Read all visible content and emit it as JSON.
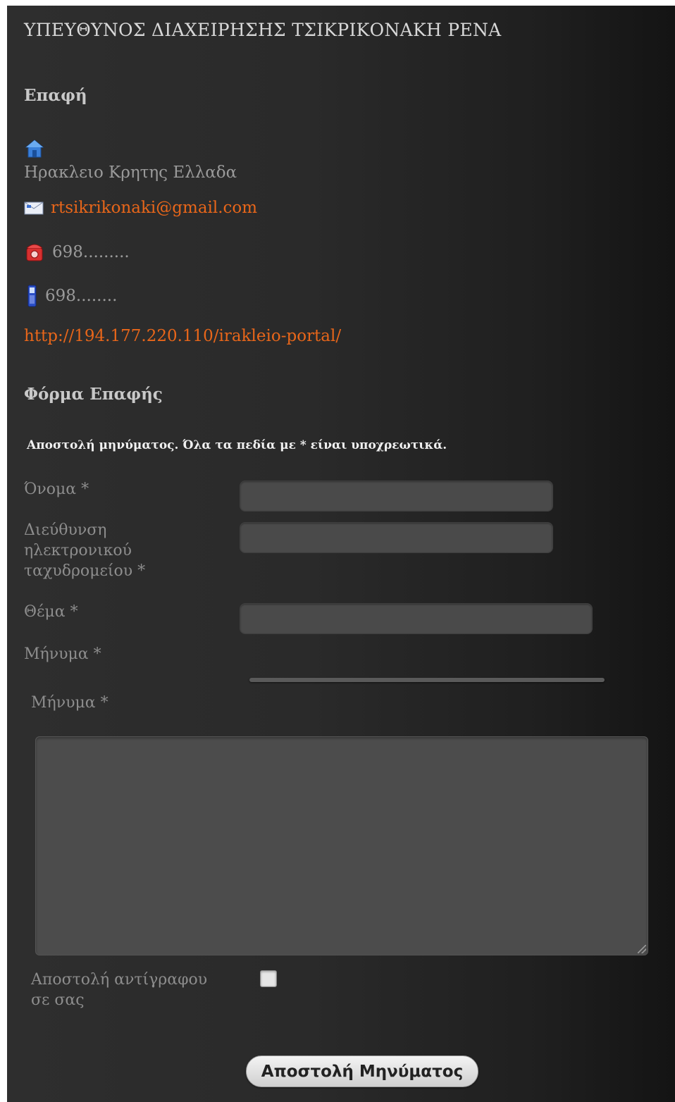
{
  "header": {
    "title": "ΥΠΕΥΘΥΝΟΣ ΔΙΑΧΕΙΡΗΣΗΣ ΤΣΙΚΡΙΚΟΝΑΚΗ ΡΕΝΑ"
  },
  "contact": {
    "heading": "Επαφή",
    "address_icon": "house-icon",
    "address": "Ηρακλειο Κρητης Ελλαδα",
    "email_icon": "envelope-icon",
    "email": "rtsikrikonaki@gmail.com",
    "phone_icon": "telephone-icon",
    "phone": "698.........",
    "mobile_icon": "mobile-phone-icon",
    "mobile": "698........",
    "website": "http://194.177.220.110/irakleio-portal/"
  },
  "form": {
    "heading": "Φόρμα Επαφής",
    "notice": "Αποστολή μηνύματος. Όλα τα πεδία με * είναι υποχρεωτικά.",
    "name_label": "Όνομα *",
    "email_label": "Διεύθυνση ηλεκτρονικού ταχυδρομείου *",
    "subject_label": "Θέμα *",
    "message_label": "Μήνυμα *",
    "message_label_2": "Μήνυμα *",
    "copy_label": "Αποστολή αντίγραφου σε σας",
    "submit_label": "Αποστολή Μηνύματος"
  },
  "colors": {
    "accent": "#e8661a",
    "background": "#2a2a2a",
    "text_muted": "#9a9a9a"
  }
}
